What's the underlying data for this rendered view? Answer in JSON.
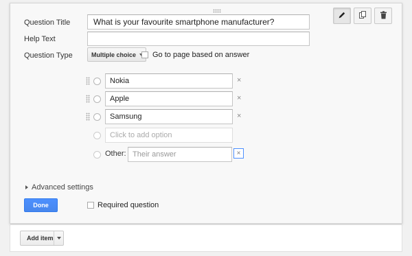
{
  "editor": {
    "labels": {
      "question_title": "Question Title",
      "help_text": "Help Text",
      "question_type": "Question Type"
    },
    "fields": {
      "question_title_value": "What is your favourite smartphone manufacturer?",
      "help_text_value": ""
    },
    "question_type_value": "Multiple choice",
    "go_to_page_label": "Go to page based on answer",
    "go_to_page_checked": false,
    "options": [
      {
        "label": "Nokia"
      },
      {
        "label": "Apple"
      },
      {
        "label": "Samsung"
      }
    ],
    "add_option_placeholder": "Click to add option",
    "other_label": "Other:",
    "other_placeholder": "Their answer",
    "remove_symbol": "×",
    "advanced_settings_label": "Advanced settings",
    "done_label": "Done",
    "required_label": "Required question",
    "required_checked": false,
    "toolbar": {
      "edit_icon": "pencil-icon",
      "duplicate_icon": "copy-icon",
      "delete_icon": "trash-icon"
    }
  },
  "footer": {
    "add_item_label": "Add item"
  },
  "colors": {
    "primary_button": "#4d90fe",
    "focus_border": "#4d90fe"
  }
}
